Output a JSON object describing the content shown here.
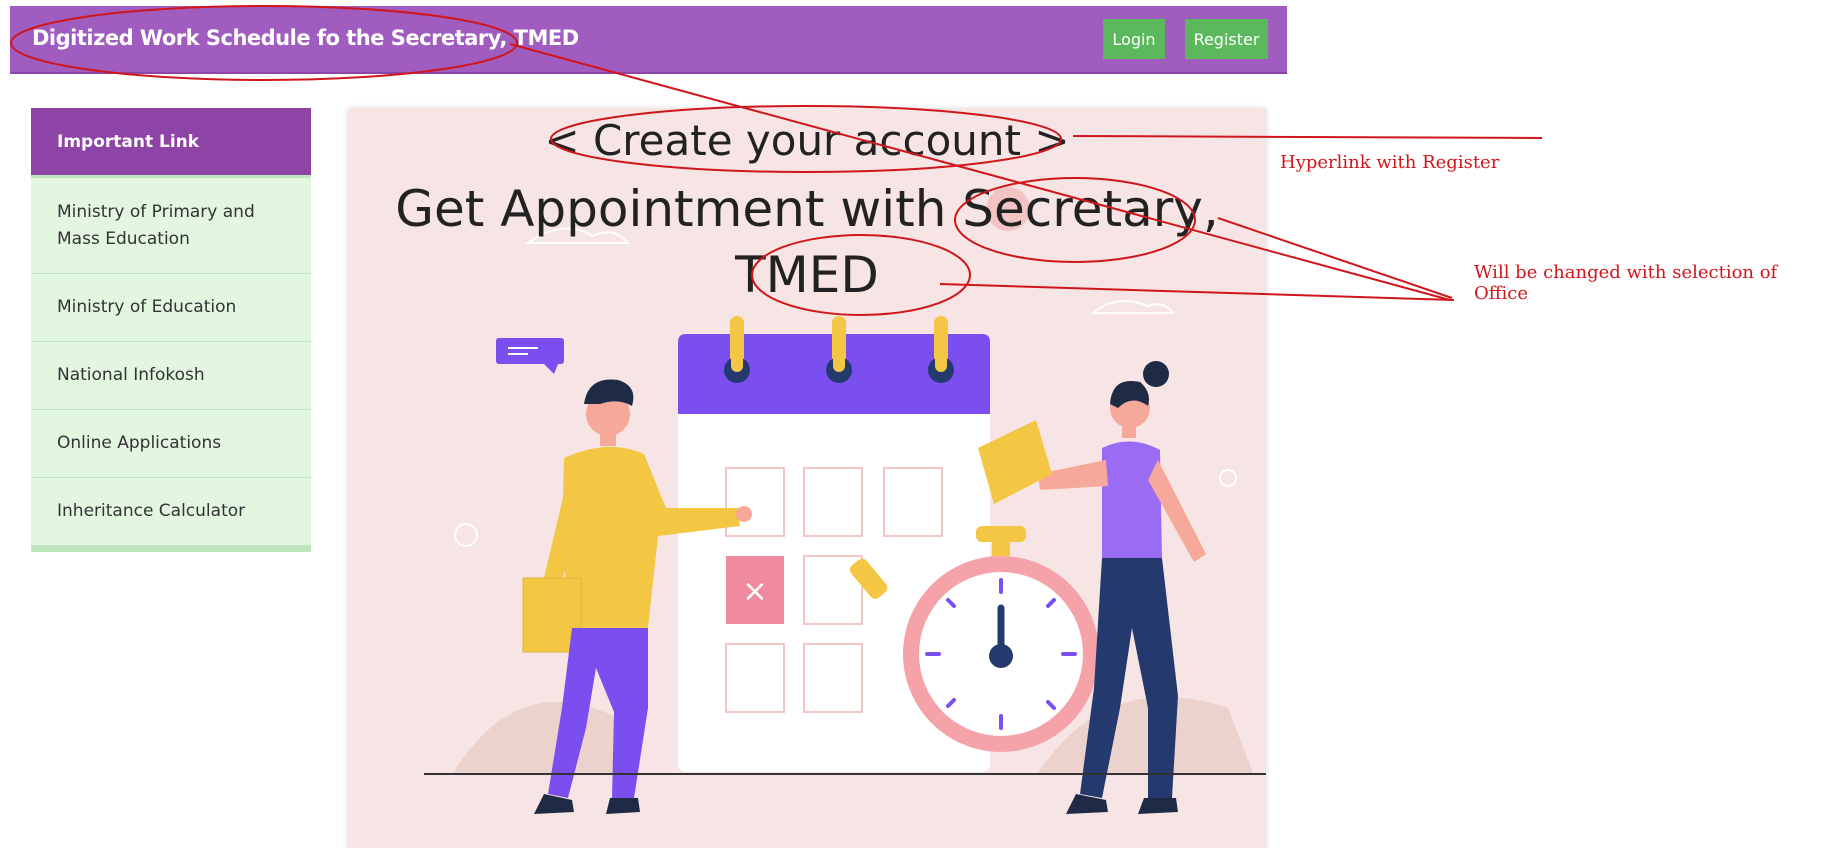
{
  "header": {
    "title": "Digitized Work Schedule fo the Secretary, TMED",
    "login_label": "Login",
    "register_label": "Register"
  },
  "sidebar": {
    "heading": "Important Link",
    "items": [
      {
        "label_line1": "Ministry of Primary and",
        "label_line2": "Mass Education"
      },
      {
        "label_line1": "Ministry of Education",
        "label_line2": ""
      },
      {
        "label_line1": "National Infokosh",
        "label_line2": ""
      },
      {
        "label_line1": "Online Applications",
        "label_line2": ""
      },
      {
        "label_line1": "Inheritance Calculator",
        "label_line2": ""
      }
    ]
  },
  "main": {
    "create_account_link": "< Create your account >",
    "title_line1": "Get Appointment with Secretary,",
    "title_line2": "TMED",
    "illustration_icon": "calendar-appointment-illustration",
    "calendar_mark": "×"
  },
  "annotations": {
    "register_note": "Hyperlink with Register",
    "office_note_line1": "Will be changed with selection of",
    "office_note_line2": "Office"
  },
  "colors": {
    "header_bg": "#a15cbf",
    "button_green": "#5cb85c",
    "sidebar_head": "#8e44a7",
    "sidebar_item_bg": "#e2f6e0",
    "card_bg": "#f6e5e4",
    "annotation_red": "#d0161b"
  }
}
